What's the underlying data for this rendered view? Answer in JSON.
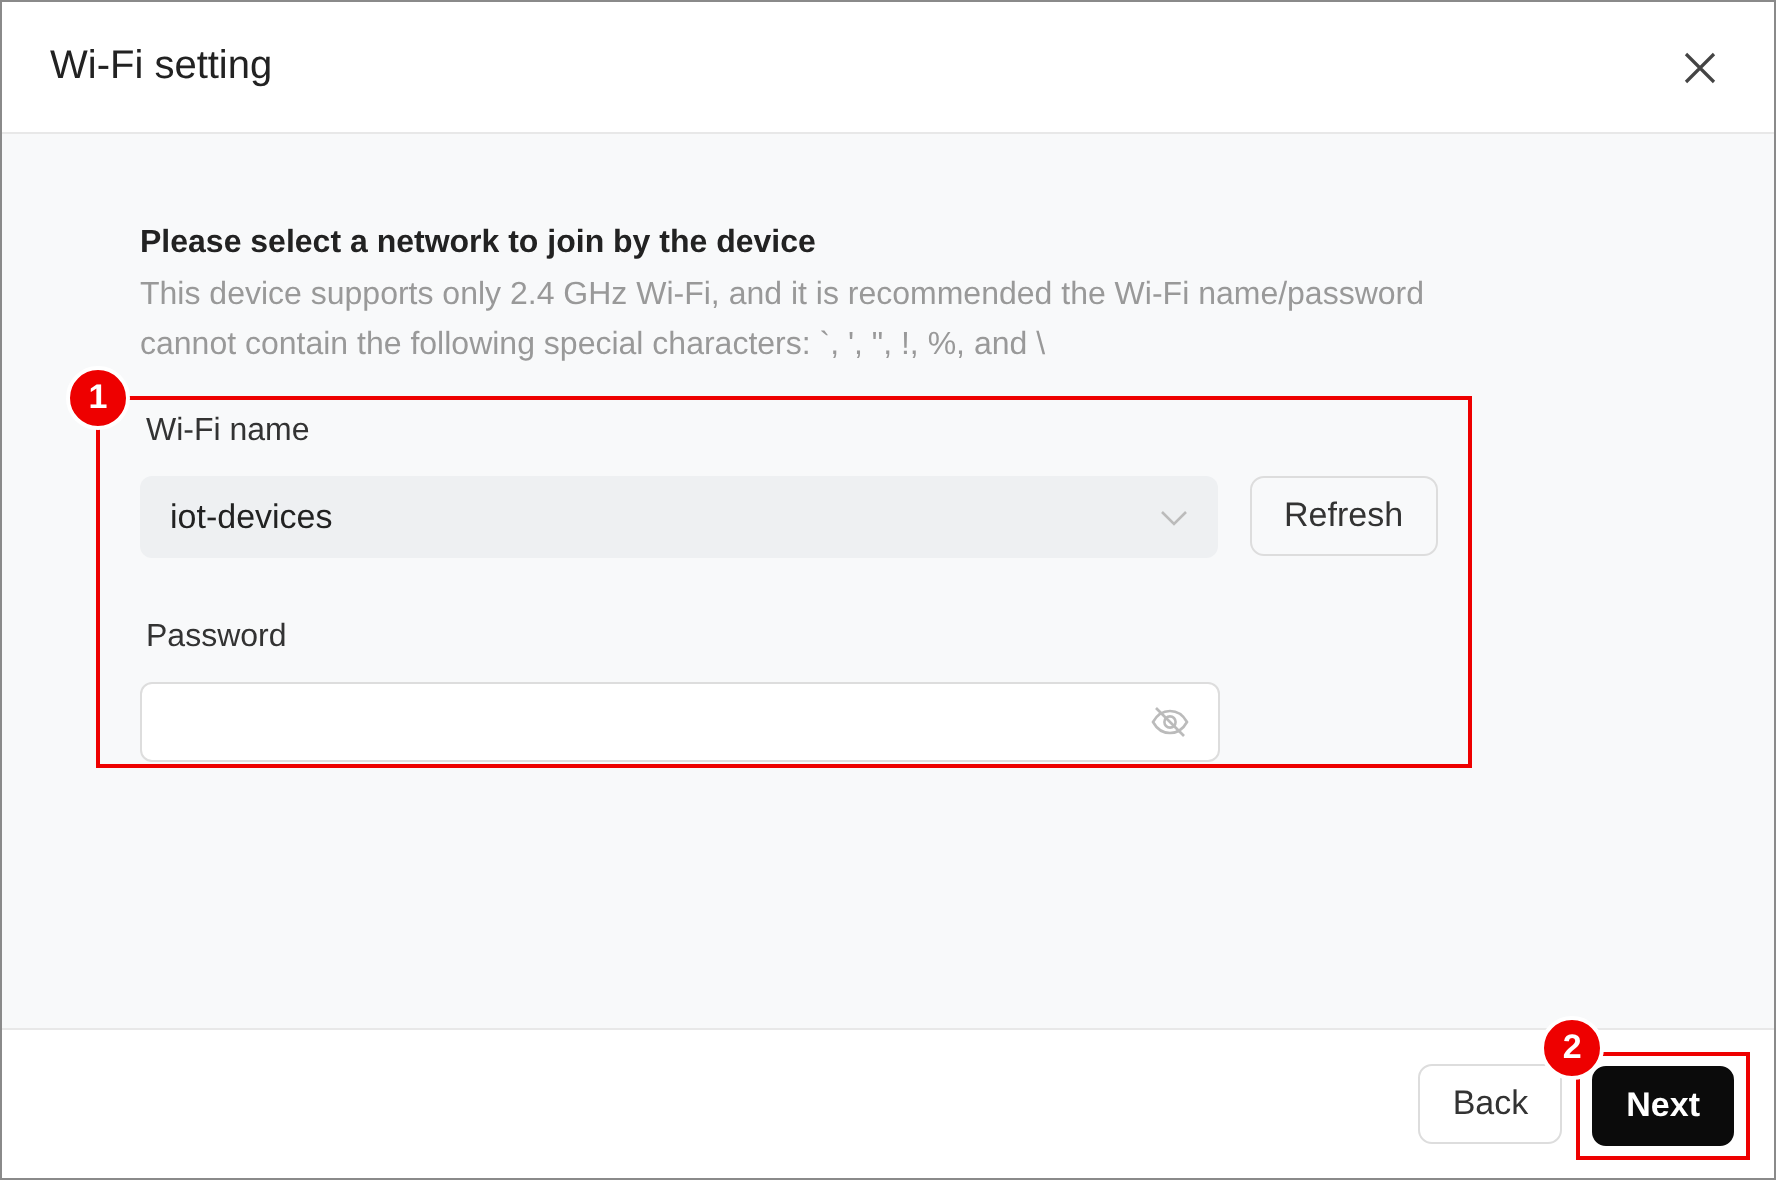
{
  "dialog": {
    "title": "Wi-Fi setting"
  },
  "intro": {
    "heading": "Please select a network to join by the device",
    "description": "This device supports only 2.4 GHz Wi-Fi, and it is recommended the Wi-Fi name/password cannot contain the following special characters: `, ', \", !, %, and \\"
  },
  "form": {
    "annotation": "1",
    "wifi_name": {
      "label": "Wi-Fi name",
      "value": "iot-devices"
    },
    "refresh_button": "Refresh",
    "password": {
      "label": "Password"
    }
  },
  "footer": {
    "buttons": [
      {
        "label": "Back",
        "kind": "secondary"
      },
      {
        "label": "Next",
        "kind": "primary",
        "annotation": "2"
      }
    ]
  }
}
